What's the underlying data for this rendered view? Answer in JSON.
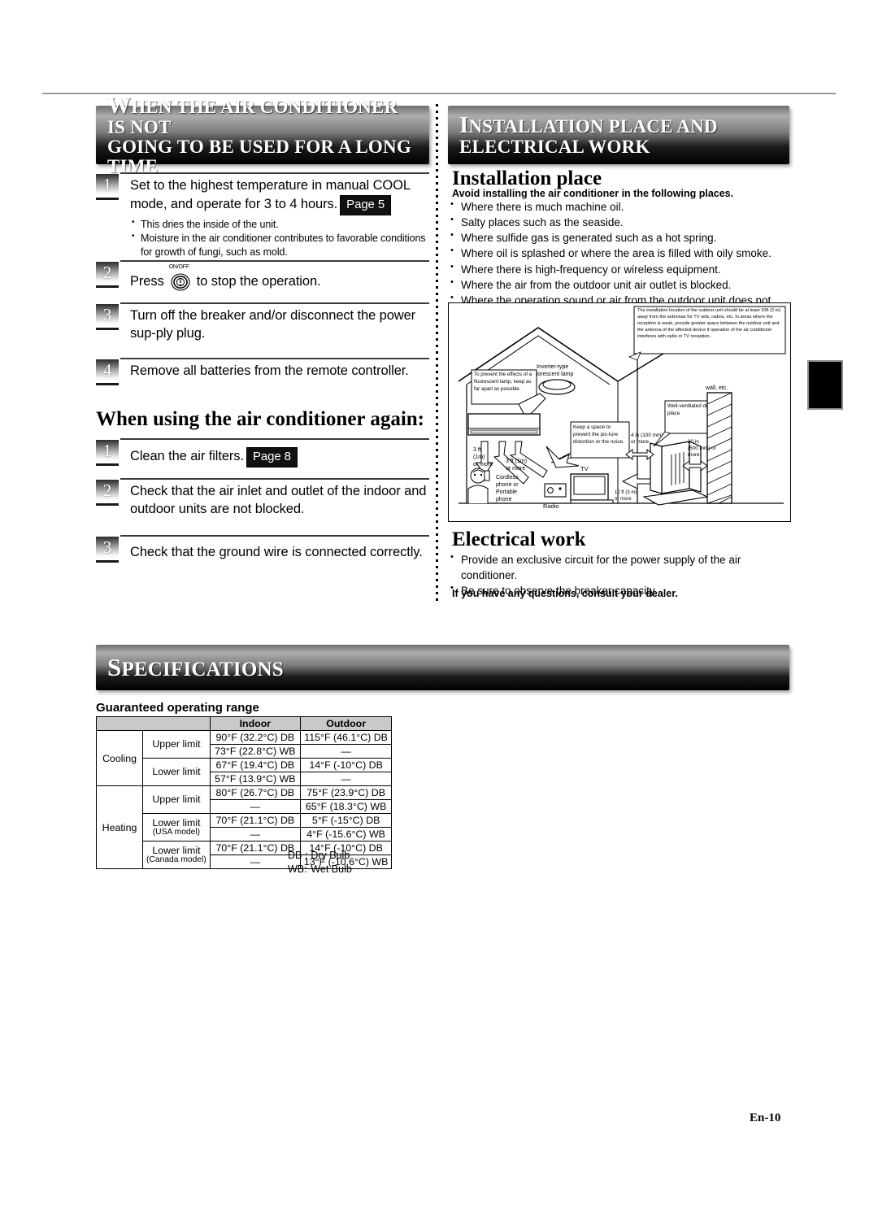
{
  "left_column": {
    "banner": {
      "initial": "W",
      "rest_line1": "HEN THE AIR CONDITIONER IS NOT",
      "line2": "GOING TO BE USED FOR A LONG TIME"
    },
    "steps": [
      {
        "number": "1",
        "text": "Set to the highest temperature in manual COOL mode, and operate for 3 to 4 hours.",
        "page_badge": "Page 5",
        "sub_bullets": [
          "This dries the inside of the unit.",
          "Moisture in the air conditioner contributes to favorable conditions for growth of fungi, such as mold."
        ]
      },
      {
        "number": "2",
        "text_before": "Press",
        "icon_label": "ON/OFF",
        "text_after": "to stop the operation."
      },
      {
        "number": "3",
        "text": "Turn off the breaker and/or disconnect the power sup-ply plug."
      },
      {
        "number": "4",
        "text": "Remove all batteries from the remote controller."
      }
    ],
    "reuse_heading": "When using the air conditioner again:",
    "reuse_steps": [
      {
        "number": "1",
        "text": "Clean the air filters.",
        "page_badge": "Page 8"
      },
      {
        "number": "2",
        "text": "Check that the air inlet and outlet of the indoor and outdoor units are not blocked."
      },
      {
        "number": "3",
        "text": "Check that the ground wire is connected correctly."
      }
    ]
  },
  "right_column": {
    "banner": {
      "initial": "I",
      "rest_line1": "NSTALLATION PLACE AND",
      "line2": "ELECTRICAL WORK"
    },
    "install_heading": "Installation place",
    "install_lead": "Avoid installing the air conditioner in the following places.",
    "install_bullets": [
      "Where there is much machine oil.",
      "Salty places such as the seaside.",
      "Where sulfide gas is generated such as a hot spring.",
      "Where oil is splashed or where the area is filled with oily smoke.",
      "Where there is high-frequency or wireless equipment.",
      "Where the air from the outdoor unit air outlet is blocked.",
      "Where the operation sound or air from the outdoor unit does not bother the house next door."
    ],
    "electrical_heading": "Electrical work",
    "electrical_bullets": [
      "Provide an exclusive circuit for the power supply of the air conditioner.",
      "Be sure to observe the breaker capacity."
    ],
    "dealer_note": "If you have any questions, consult your dealer."
  },
  "diagram": {
    "antenna_note": "The installation location of the outdoor unit should be at least 10ft (3 m) away from the antennas for TV sets, radios, etc. In areas where the reception is weak, provide greater space between the outdoor unit and the antenna of the affected device if operation of the air conditioner interferes with radio or TV reception.",
    "lamp_label_l1": "Inverter-type",
    "lamp_label_l2": "fluorescent lamp",
    "fluorescent_bubble": "To prevent the effects of a fluorescent lamp, keep as far apart as possible.",
    "picture_bubble": "Keep a space to prevent the pic-ture distortion or the noise.",
    "ventilated_bubble": "Well-ventilated dry place",
    "wall_label": "wall, etc.",
    "dist_phone_l1": "3 ft",
    "dist_phone_l2": "(1m)",
    "dist_phone_l3": "or more",
    "dist_radio_l1": "3 ft (1m)",
    "dist_radio_l2": "or more",
    "dist_tv_l1": "10 ft (3 m)",
    "dist_tv_l2": "or more",
    "dist_back_l1": "4 in (100 mm)",
    "dist_back_l2": "or more",
    "dist_wall_l1": "20 in",
    "dist_wall_l2": "(500 mm) or",
    "dist_wall_l3": "more",
    "phone_label_l1": "Cordless",
    "phone_label_l2": "phone or",
    "phone_label_l3": "Portable",
    "phone_label_l4": "phone",
    "radio_label": "Radio",
    "tv_label": "TV"
  },
  "specifications": {
    "banner": {
      "initial": "S",
      "rest_line1": "PECIFICATIONS"
    },
    "table_title": "Guaranteed operating range",
    "columns": [
      "Indoor",
      "Outdoor"
    ],
    "rows": [
      {
        "mode": "Cooling",
        "limit": "Upper limit",
        "indoor": "90°F (32.2°C) DB",
        "outdoor": "115°F (46.1°C) DB"
      },
      {
        "mode": "Cooling",
        "limit": "Upper limit",
        "indoor": "73°F (22.8°C) WB",
        "outdoor": "—"
      },
      {
        "mode": "Cooling",
        "limit": "Lower limit",
        "indoor": "67°F (19.4°C) DB",
        "outdoor": "14°F (-10°C) DB"
      },
      {
        "mode": "Cooling",
        "limit": "Lower limit",
        "indoor": "57°F (13.9°C) WB",
        "outdoor": "—"
      },
      {
        "mode": "Heating",
        "limit": "Upper limit",
        "indoor": "80°F (26.7°C) DB",
        "outdoor": "75°F (23.9°C) DB"
      },
      {
        "mode": "Heating",
        "limit": "Upper limit",
        "indoor": "—",
        "outdoor": "65°F (18.3°C) WB"
      },
      {
        "mode": "Heating",
        "limit": "Lower limit",
        "limit_sub": "(USA model)",
        "indoor": "70°F (21.1°C) DB",
        "outdoor": "5°F (-15°C) DB"
      },
      {
        "mode": "Heating",
        "limit": "Lower limit",
        "limit_sub": "(USA model)",
        "indoor": "—",
        "outdoor": "4°F (-15.6°C) WB"
      },
      {
        "mode": "Heating",
        "limit": "Lower limit",
        "limit_sub": "(Canada model)",
        "indoor": "70°F (21.1°C) DB",
        "outdoor": "14°F (-10°C) DB"
      },
      {
        "mode": "Heating",
        "limit": "Lower limit",
        "limit_sub": "(Canada model)",
        "indoor": "—",
        "outdoor": "13°F (-10.6°C) WB"
      }
    ],
    "legend": [
      {
        "abbr": "DB :",
        "meaning": "Dry Bulb"
      },
      {
        "abbr": "WB:",
        "meaning": "Wet Bulb"
      }
    ]
  },
  "footer": {
    "page_number": "En-10"
  }
}
